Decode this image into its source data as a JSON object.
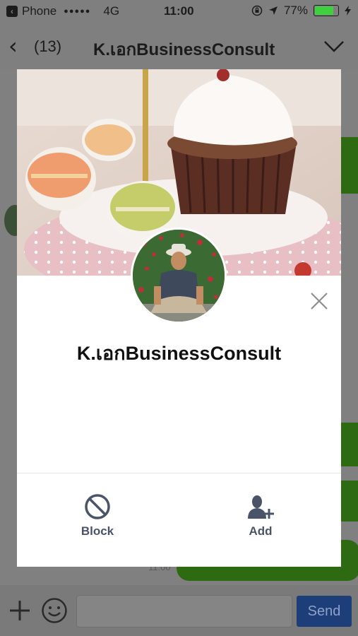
{
  "status_bar": {
    "carrier": "Phone",
    "signal": "●●●●●",
    "network": "4G",
    "time": "11:00",
    "battery": "77%",
    "battery_level": 0.77
  },
  "nav": {
    "back_count": "(13)",
    "title": "K.เอกBusinessConsult"
  },
  "chat": {
    "timestamp": "11:00",
    "send_label": "Send"
  },
  "profile": {
    "name": "K.เอกBusinessConsult",
    "actions": [
      {
        "label": "Block",
        "icon": "block-icon"
      },
      {
        "label": "Add",
        "icon": "add-friend-icon"
      }
    ]
  },
  "colors": {
    "action_text": "#4a5468",
    "send_button": "#1e3e7a",
    "chat_bubble": "#2d6a12"
  }
}
